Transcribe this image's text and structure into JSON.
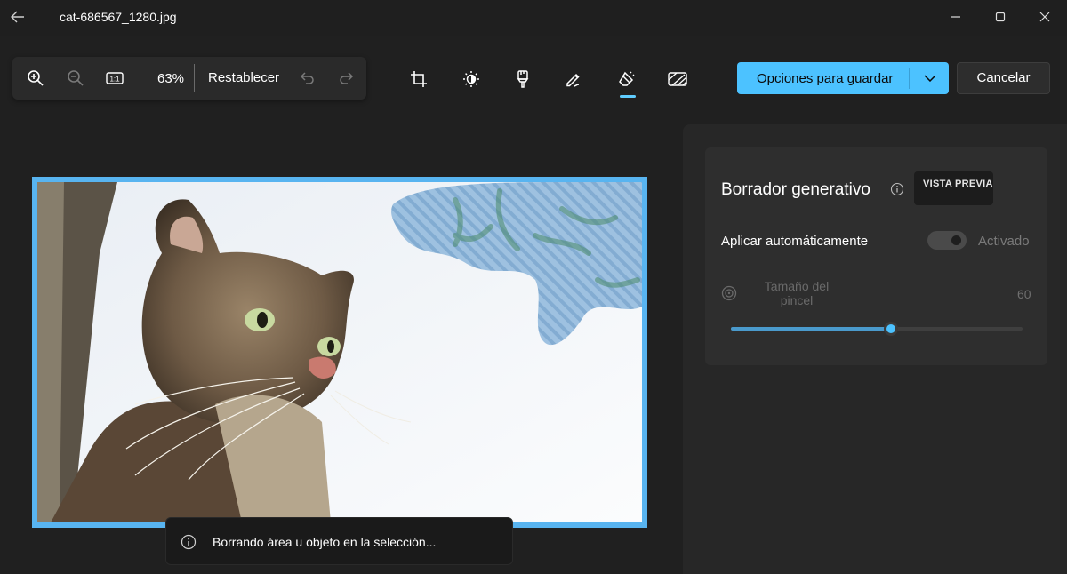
{
  "titlebar": {
    "filename": "cat-686567_1280.jpg"
  },
  "toolbar": {
    "zoom_value": "63%",
    "reset_label": "Restablecer",
    "fit_label": "1:1"
  },
  "actions": {
    "save_label": "Opciones para guardar",
    "cancel_label": "Cancelar"
  },
  "toast": {
    "message": "Borrando área u objeto en la selección..."
  },
  "panel": {
    "title": "Borrador generativo",
    "badge": "VISTA PREVIA",
    "auto_apply_label": "Aplicar automáticamente",
    "auto_apply_state": "Activado",
    "brush_size_label": "Tamaño del pincel",
    "brush_size_value": "60",
    "brush_size_fraction": 0.55
  },
  "colors": {
    "accent": "#4cc2ff",
    "background": "#202020",
    "panel": "#272727",
    "card": "#2e2e2e",
    "selection_border": "#58b4f0"
  },
  "icons": {
    "back": "arrow-left-icon",
    "zoom_in": "zoom-in-icon",
    "zoom_out": "zoom-out-icon",
    "actual_size": "actual-size-icon",
    "undo": "undo-icon",
    "redo": "redo-icon",
    "crop": "crop-icon",
    "adjust": "brightness-icon",
    "filter": "filter-icon",
    "markup": "pen-icon",
    "erase": "eraser-icon",
    "background": "background-blur-icon",
    "info": "info-icon",
    "brush": "brush-size-icon"
  }
}
